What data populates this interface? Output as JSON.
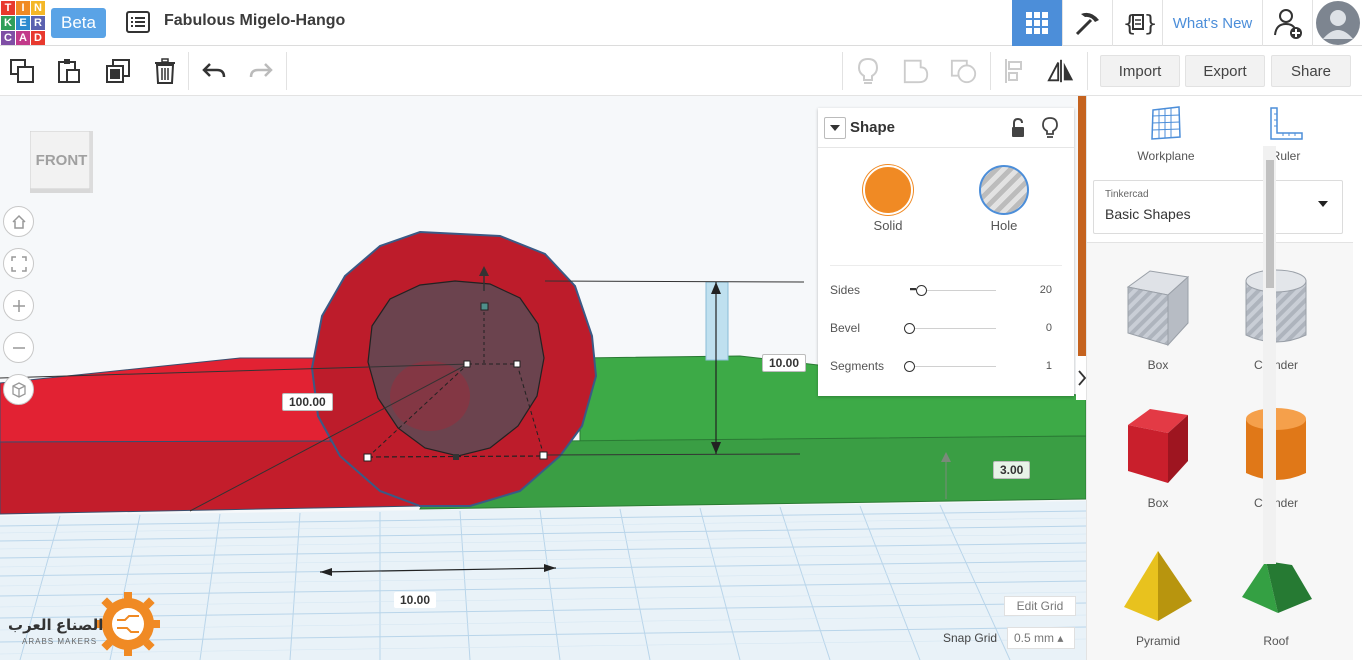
{
  "app": {
    "logo_letters": [
      "T",
      "I",
      "N",
      "K",
      "E",
      "R",
      "C",
      "A",
      "D"
    ],
    "logo_colors": [
      "#e8392e",
      "#f08a24",
      "#f4b728",
      "#2f9f5b",
      "#2e8bcf",
      "#5b61b0",
      "#7f4ea5",
      "#c23a8a",
      "#e8392e"
    ],
    "beta_label": "Beta",
    "design_title": "Fabulous Migelo-Hango",
    "whats_new": "What's New"
  },
  "toolbar": {
    "import_label": "Import",
    "export_label": "Export",
    "share_label": "Share"
  },
  "viewcube": {
    "face_label": "FRONT"
  },
  "dimensions": {
    "width_label": "100.00",
    "height_label": "10.00",
    "elevation_label": "3.00",
    "grid_length_label": "10.00"
  },
  "inspector": {
    "title": "Shape",
    "solid_label": "Solid",
    "hole_label": "Hole",
    "solid_color": "#f08a24",
    "params": [
      {
        "name": "Sides",
        "value": "20",
        "fraction": 0.14
      },
      {
        "name": "Bevel",
        "value": "0",
        "fraction": 0.0
      },
      {
        "name": "Segments",
        "value": "1",
        "fraction": 0.0
      }
    ]
  },
  "right_panel": {
    "workplane_label": "Workplane",
    "ruler_label": "Ruler",
    "library_source": "Tinkercad",
    "library_name": "Basic Shapes",
    "shapes": [
      {
        "label": "Box",
        "kind": "hole-box"
      },
      {
        "label": "Cylinder",
        "kind": "hole-cylinder"
      },
      {
        "label": "Box",
        "kind": "box"
      },
      {
        "label": "Cylinder",
        "kind": "cylinder"
      },
      {
        "label": "Pyramid",
        "kind": "pyramid"
      },
      {
        "label": "Roof",
        "kind": "roof"
      }
    ]
  },
  "grid_controls": {
    "edit_grid_label": "Edit Grid",
    "snap_grid_label": "Snap Grid",
    "snap_grid_value": "0.5 mm ▴"
  },
  "watermark": {
    "arabic_text": "الصناع العرب",
    "english_text": "ARABS MAKERS"
  }
}
